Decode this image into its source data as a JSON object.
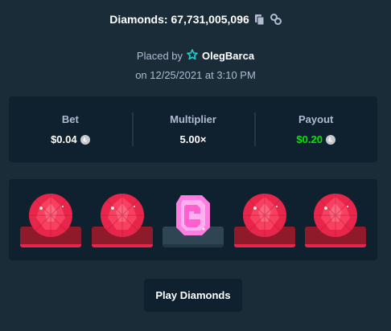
{
  "header": {
    "title": "Diamonds: 67,731,005,096",
    "copy_icon": "copy-icon",
    "link_icon": "link-icon"
  },
  "placed": {
    "prefix": "Placed by",
    "user": "OlegBarca",
    "user_icon": "star-badge-icon",
    "date": "on 12/25/2021 at 3:10 PM"
  },
  "stats": {
    "bet_label": "Bet",
    "bet_value": "$0.04",
    "multiplier_label": "Multiplier",
    "multiplier_value": "5.00×",
    "payout_label": "Payout",
    "payout_value": "$0.20",
    "currency_icon": "litecoin-icon"
  },
  "gems": [
    {
      "type": "red-diamond",
      "pedestal": "red"
    },
    {
      "type": "red-diamond",
      "pedestal": "red"
    },
    {
      "type": "pink-gem",
      "pedestal": "dark"
    },
    {
      "type": "red-diamond",
      "pedestal": "red"
    },
    {
      "type": "red-diamond",
      "pedestal": "red"
    }
  ],
  "colors": {
    "background": "#1a2c38",
    "panel": "#0f212e",
    "payout_green": "#00e701",
    "gem_red": "#e8264b",
    "gem_pink": "#ff7de0"
  },
  "actions": {
    "play_label": "Play Diamonds"
  }
}
